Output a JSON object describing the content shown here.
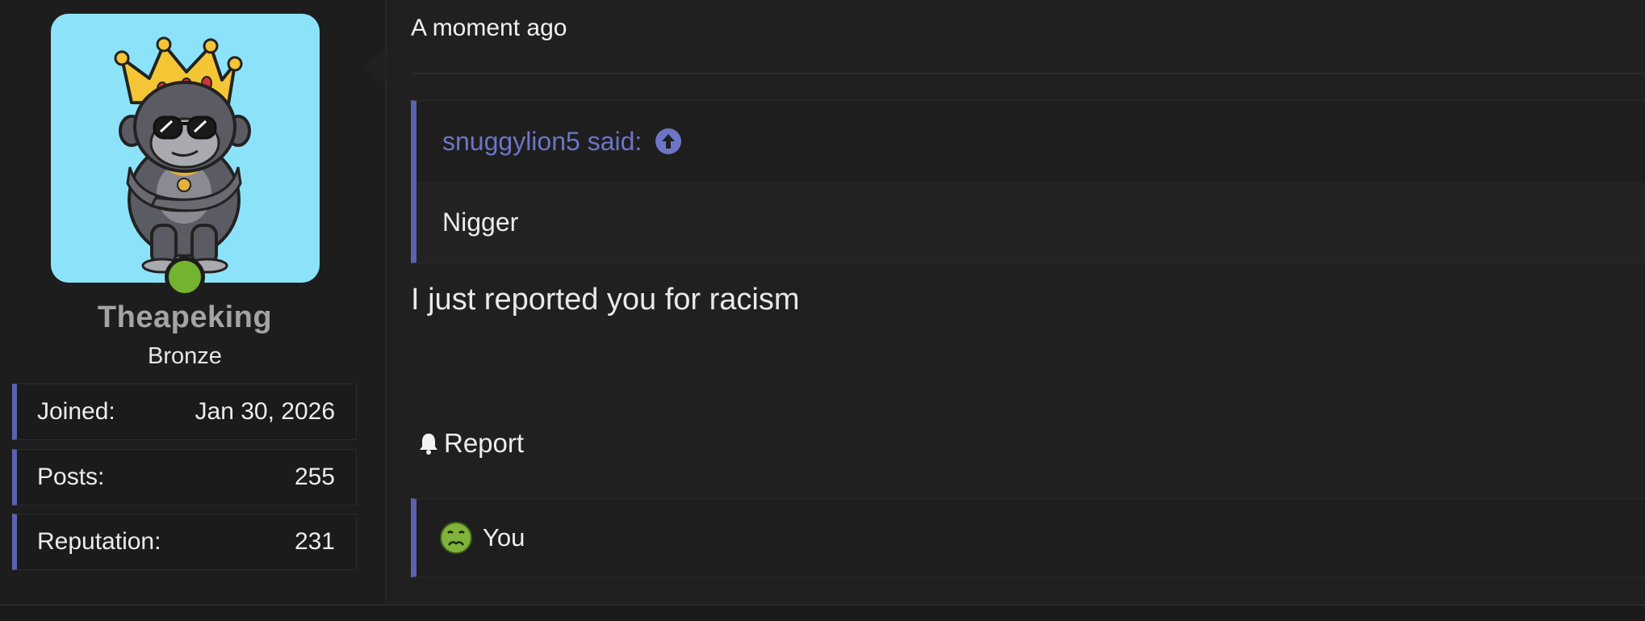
{
  "author": {
    "username": "Theapeking",
    "user_title": "Bronze",
    "online": true,
    "stats": [
      {
        "label": "Joined:",
        "value": "Jan 30, 2026"
      },
      {
        "label": "Posts:",
        "value": "255"
      },
      {
        "label": "Reputation:",
        "value": "231"
      }
    ]
  },
  "post": {
    "timestamp": "A moment ago",
    "quote": {
      "attribution": "snuggylion5 said:",
      "text": "Nigger"
    },
    "message": "I just reported you for racism",
    "report_label": "Report",
    "reactions_label": "You"
  },
  "icons": {
    "quote_jump": "arrow-up-circle-icon",
    "report": "bell-icon",
    "reaction": "nauseated-face-icon"
  },
  "colors": {
    "accent": "#5a62ad",
    "link": "#6d75c6",
    "online": "#74b32f",
    "avatar_bg": "#8ce3f9"
  }
}
